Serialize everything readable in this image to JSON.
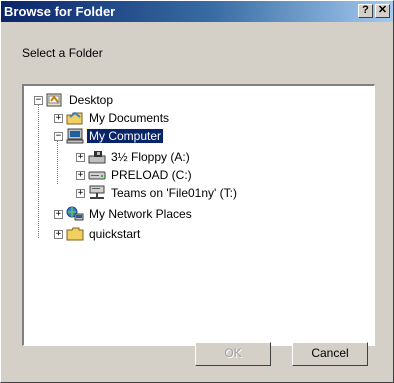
{
  "window": {
    "title": "Browse for Folder",
    "help_button": "?",
    "close_button": "✕"
  },
  "prompt": "Select a Folder",
  "tree": {
    "items": [
      {
        "label": "Desktop",
        "expander": "−",
        "icon": "desktop-icon"
      },
      {
        "label": "My Documents",
        "expander": "+",
        "icon": "my-documents-icon"
      },
      {
        "label": "My Computer",
        "expander": "−",
        "icon": "my-computer-icon",
        "selected": true
      },
      {
        "label": "3½ Floppy (A:)",
        "expander": "+",
        "icon": "floppy-drive-icon"
      },
      {
        "label": "PRELOAD (C:)",
        "expander": "+",
        "icon": "hard-drive-icon"
      },
      {
        "label": "Teams on 'File01ny' (T:)",
        "expander": "+",
        "icon": "network-drive-icon"
      },
      {
        "label": "My Network Places",
        "expander": "+",
        "icon": "network-places-icon"
      },
      {
        "label": "quickstart",
        "expander": "+",
        "icon": "folder-icon"
      }
    ]
  },
  "buttons": {
    "ok": "OK",
    "cancel": "Cancel"
  }
}
